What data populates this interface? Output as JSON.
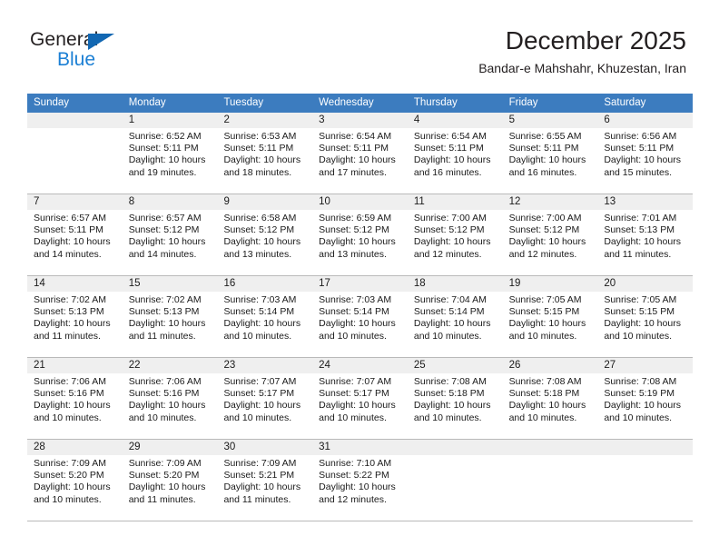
{
  "brand": {
    "name_part1": "General",
    "name_part2": "Blue",
    "triangle_color": "#1267b2",
    "blue_color": "#1b7fd4"
  },
  "header": {
    "title": "December 2025",
    "subtitle": "Bandar-e Mahshahr, Khuzestan, Iran"
  },
  "theme": {
    "header_row_bg": "#3c7cbf",
    "daynum_band_bg": "#efefef",
    "grid_line": "#b9b9b9",
    "text": "#1a1a1a"
  },
  "weekdays": [
    "Sunday",
    "Monday",
    "Tuesday",
    "Wednesday",
    "Thursday",
    "Friday",
    "Saturday"
  ],
  "labels": {
    "sunrise_prefix": "Sunrise:",
    "sunset_prefix": "Sunset:",
    "daylight_prefix": "Daylight:"
  },
  "weeks": [
    [
      {
        "day": "",
        "blank": true,
        "sunrise": "",
        "sunset": "",
        "daylight_line1": "",
        "daylight_line2": ""
      },
      {
        "day": "1",
        "sunrise": "Sunrise: 6:52 AM",
        "sunset": "Sunset: 5:11 PM",
        "daylight_line1": "Daylight: 10 hours",
        "daylight_line2": "and 19 minutes."
      },
      {
        "day": "2",
        "sunrise": "Sunrise: 6:53 AM",
        "sunset": "Sunset: 5:11 PM",
        "daylight_line1": "Daylight: 10 hours",
        "daylight_line2": "and 18 minutes."
      },
      {
        "day": "3",
        "sunrise": "Sunrise: 6:54 AM",
        "sunset": "Sunset: 5:11 PM",
        "daylight_line1": "Daylight: 10 hours",
        "daylight_line2": "and 17 minutes."
      },
      {
        "day": "4",
        "sunrise": "Sunrise: 6:54 AM",
        "sunset": "Sunset: 5:11 PM",
        "daylight_line1": "Daylight: 10 hours",
        "daylight_line2": "and 16 minutes."
      },
      {
        "day": "5",
        "sunrise": "Sunrise: 6:55 AM",
        "sunset": "Sunset: 5:11 PM",
        "daylight_line1": "Daylight: 10 hours",
        "daylight_line2": "and 16 minutes."
      },
      {
        "day": "6",
        "sunrise": "Sunrise: 6:56 AM",
        "sunset": "Sunset: 5:11 PM",
        "daylight_line1": "Daylight: 10 hours",
        "daylight_line2": "and 15 minutes."
      }
    ],
    [
      {
        "day": "7",
        "sunrise": "Sunrise: 6:57 AM",
        "sunset": "Sunset: 5:11 PM",
        "daylight_line1": "Daylight: 10 hours",
        "daylight_line2": "and 14 minutes."
      },
      {
        "day": "8",
        "sunrise": "Sunrise: 6:57 AM",
        "sunset": "Sunset: 5:12 PM",
        "daylight_line1": "Daylight: 10 hours",
        "daylight_line2": "and 14 minutes."
      },
      {
        "day": "9",
        "sunrise": "Sunrise: 6:58 AM",
        "sunset": "Sunset: 5:12 PM",
        "daylight_line1": "Daylight: 10 hours",
        "daylight_line2": "and 13 minutes."
      },
      {
        "day": "10",
        "sunrise": "Sunrise: 6:59 AM",
        "sunset": "Sunset: 5:12 PM",
        "daylight_line1": "Daylight: 10 hours",
        "daylight_line2": "and 13 minutes."
      },
      {
        "day": "11",
        "sunrise": "Sunrise: 7:00 AM",
        "sunset": "Sunset: 5:12 PM",
        "daylight_line1": "Daylight: 10 hours",
        "daylight_line2": "and 12 minutes."
      },
      {
        "day": "12",
        "sunrise": "Sunrise: 7:00 AM",
        "sunset": "Sunset: 5:12 PM",
        "daylight_line1": "Daylight: 10 hours",
        "daylight_line2": "and 12 minutes."
      },
      {
        "day": "13",
        "sunrise": "Sunrise: 7:01 AM",
        "sunset": "Sunset: 5:13 PM",
        "daylight_line1": "Daylight: 10 hours",
        "daylight_line2": "and 11 minutes."
      }
    ],
    [
      {
        "day": "14",
        "sunrise": "Sunrise: 7:02 AM",
        "sunset": "Sunset: 5:13 PM",
        "daylight_line1": "Daylight: 10 hours",
        "daylight_line2": "and 11 minutes."
      },
      {
        "day": "15",
        "sunrise": "Sunrise: 7:02 AM",
        "sunset": "Sunset: 5:13 PM",
        "daylight_line1": "Daylight: 10 hours",
        "daylight_line2": "and 11 minutes."
      },
      {
        "day": "16",
        "sunrise": "Sunrise: 7:03 AM",
        "sunset": "Sunset: 5:14 PM",
        "daylight_line1": "Daylight: 10 hours",
        "daylight_line2": "and 10 minutes."
      },
      {
        "day": "17",
        "sunrise": "Sunrise: 7:03 AM",
        "sunset": "Sunset: 5:14 PM",
        "daylight_line1": "Daylight: 10 hours",
        "daylight_line2": "and 10 minutes."
      },
      {
        "day": "18",
        "sunrise": "Sunrise: 7:04 AM",
        "sunset": "Sunset: 5:14 PM",
        "daylight_line1": "Daylight: 10 hours",
        "daylight_line2": "and 10 minutes."
      },
      {
        "day": "19",
        "sunrise": "Sunrise: 7:05 AM",
        "sunset": "Sunset: 5:15 PM",
        "daylight_line1": "Daylight: 10 hours",
        "daylight_line2": "and 10 minutes."
      },
      {
        "day": "20",
        "sunrise": "Sunrise: 7:05 AM",
        "sunset": "Sunset: 5:15 PM",
        "daylight_line1": "Daylight: 10 hours",
        "daylight_line2": "and 10 minutes."
      }
    ],
    [
      {
        "day": "21",
        "sunrise": "Sunrise: 7:06 AM",
        "sunset": "Sunset: 5:16 PM",
        "daylight_line1": "Daylight: 10 hours",
        "daylight_line2": "and 10 minutes."
      },
      {
        "day": "22",
        "sunrise": "Sunrise: 7:06 AM",
        "sunset": "Sunset: 5:16 PM",
        "daylight_line1": "Daylight: 10 hours",
        "daylight_line2": "and 10 minutes."
      },
      {
        "day": "23",
        "sunrise": "Sunrise: 7:07 AM",
        "sunset": "Sunset: 5:17 PM",
        "daylight_line1": "Daylight: 10 hours",
        "daylight_line2": "and 10 minutes."
      },
      {
        "day": "24",
        "sunrise": "Sunrise: 7:07 AM",
        "sunset": "Sunset: 5:17 PM",
        "daylight_line1": "Daylight: 10 hours",
        "daylight_line2": "and 10 minutes."
      },
      {
        "day": "25",
        "sunrise": "Sunrise: 7:08 AM",
        "sunset": "Sunset: 5:18 PM",
        "daylight_line1": "Daylight: 10 hours",
        "daylight_line2": "and 10 minutes."
      },
      {
        "day": "26",
        "sunrise": "Sunrise: 7:08 AM",
        "sunset": "Sunset: 5:18 PM",
        "daylight_line1": "Daylight: 10 hours",
        "daylight_line2": "and 10 minutes."
      },
      {
        "day": "27",
        "sunrise": "Sunrise: 7:08 AM",
        "sunset": "Sunset: 5:19 PM",
        "daylight_line1": "Daylight: 10 hours",
        "daylight_line2": "and 10 minutes."
      }
    ],
    [
      {
        "day": "28",
        "sunrise": "Sunrise: 7:09 AM",
        "sunset": "Sunset: 5:20 PM",
        "daylight_line1": "Daylight: 10 hours",
        "daylight_line2": "and 10 minutes."
      },
      {
        "day": "29",
        "sunrise": "Sunrise: 7:09 AM",
        "sunset": "Sunset: 5:20 PM",
        "daylight_line1": "Daylight: 10 hours",
        "daylight_line2": "and 11 minutes."
      },
      {
        "day": "30",
        "sunrise": "Sunrise: 7:09 AM",
        "sunset": "Sunset: 5:21 PM",
        "daylight_line1": "Daylight: 10 hours",
        "daylight_line2": "and 11 minutes."
      },
      {
        "day": "31",
        "sunrise": "Sunrise: 7:10 AM",
        "sunset": "Sunset: 5:22 PM",
        "daylight_line1": "Daylight: 10 hours",
        "daylight_line2": "and 12 minutes."
      },
      {
        "day": "",
        "blank": true,
        "sunrise": "",
        "sunset": "",
        "daylight_line1": "",
        "daylight_line2": ""
      },
      {
        "day": "",
        "blank": true,
        "sunrise": "",
        "sunset": "",
        "daylight_line1": "",
        "daylight_line2": ""
      },
      {
        "day": "",
        "blank": true,
        "sunrise": "",
        "sunset": "",
        "daylight_line1": "",
        "daylight_line2": ""
      }
    ]
  ]
}
